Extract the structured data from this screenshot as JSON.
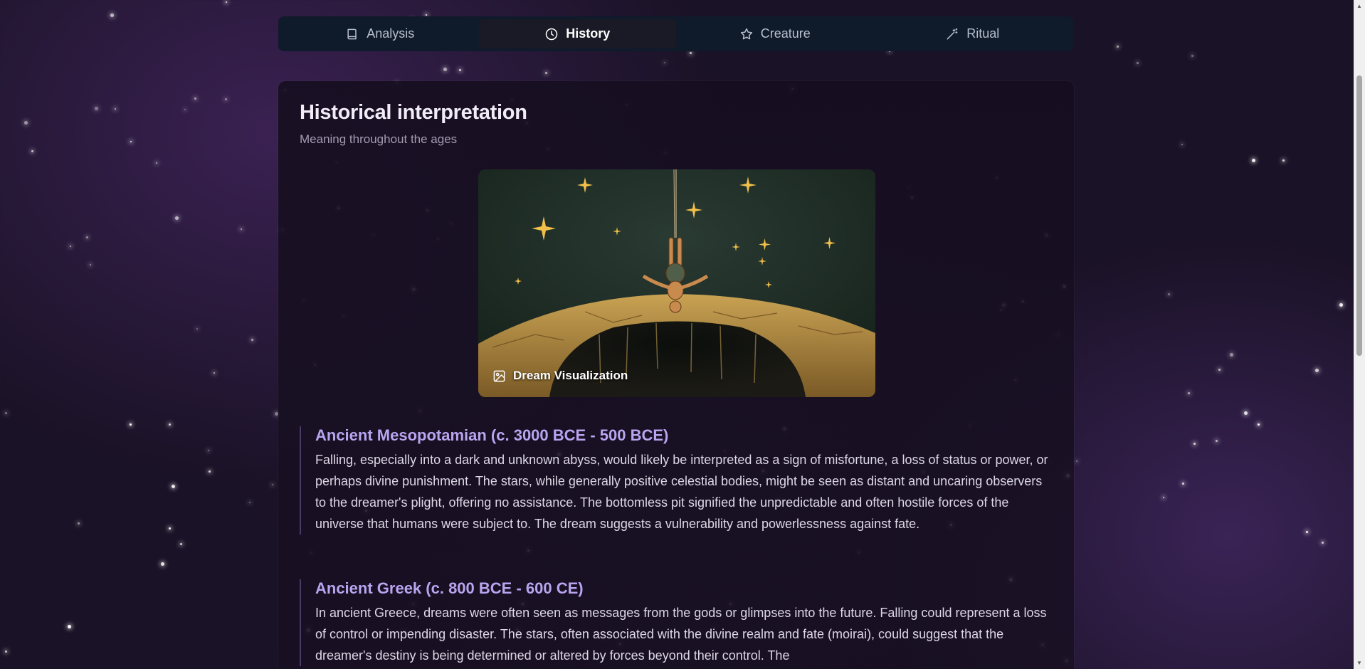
{
  "tabs": [
    {
      "label": "Analysis",
      "icon": "book-icon",
      "active": false
    },
    {
      "label": "History",
      "icon": "clock-icon",
      "active": true
    },
    {
      "label": "Creature",
      "icon": "star-icon",
      "active": false
    },
    {
      "label": "Ritual",
      "icon": "magic-wand-icon",
      "active": false
    }
  ],
  "card": {
    "title": "Historical interpretation",
    "subtitle": "Meaning throughout the ages",
    "image_caption": "Dream Visualization"
  },
  "sections": [
    {
      "heading": "Ancient Mesopotamian (c. 3000 BCE - 500 BCE)",
      "body": "Falling, especially into a dark and unknown abyss, would likely be interpreted as a sign of misfortune, a loss of status or power, or perhaps divine punishment. The stars, while generally positive celestial bodies, might be seen as distant and uncaring observers to the dreamer's plight, offering no assistance. The bottomless pit signified the unpredictable and often hostile forces of the universe that humans were subject to. The dream suggests a vulnerability and powerlessness against fate."
    },
    {
      "heading": "Ancient Greek (c. 800 BCE - 600 CE)",
      "body": "In ancient Greece, dreams were often seen as messages from the gods or glimpses into the future. Falling could represent a loss of control or impending disaster. The stars, often associated with the divine realm and fate (moirai), could suggest that the dreamer's destiny is being determined or altered by forces beyond their control. The"
    }
  ],
  "colors": {
    "accent_heading": "#b9a4f0",
    "tab_bar_bg": "#0f1a2b",
    "page_bg": "#1a1226"
  }
}
